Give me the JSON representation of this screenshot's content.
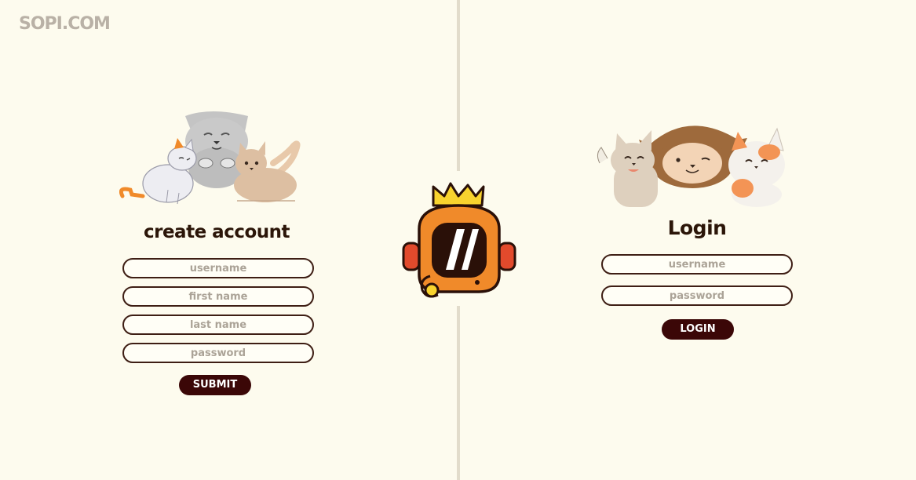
{
  "brand": "SOPI.COM",
  "create_account": {
    "title": "create account",
    "fields": {
      "username": {
        "placeholder": "username",
        "value": ""
      },
      "first_name": {
        "placeholder": "first name",
        "value": ""
      },
      "last_name": {
        "placeholder": "last name",
        "value": ""
      },
      "password": {
        "placeholder": "password",
        "value": ""
      }
    },
    "submit_label": "SUBMIT"
  },
  "login": {
    "title": "Login",
    "fields": {
      "username": {
        "placeholder": "username",
        "value": ""
      },
      "password": {
        "placeholder": "password",
        "value": ""
      }
    },
    "submit_label": "LOGIN"
  },
  "icons": {
    "brand_mascot": "crowned-robot-icon",
    "signup_illustration": "cats-group-illustration",
    "login_illustration": "cats-waving-illustration"
  },
  "colors": {
    "background": "#fdfbee",
    "text_dark": "#2b1508",
    "field_border": "#3e1e14",
    "button": "#3b0707",
    "placeholder": "#aba397",
    "brand": "#b9b1a6",
    "divider": "#e2dccb",
    "mascot_orange": "#f08a2a",
    "mascot_red": "#e24a2c",
    "crown_yellow": "#f8d32e"
  }
}
